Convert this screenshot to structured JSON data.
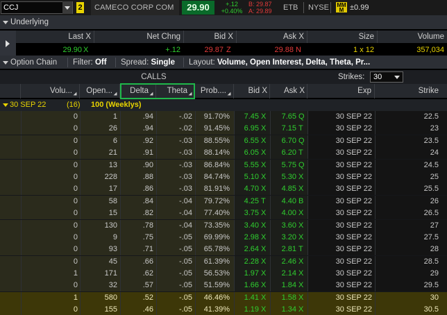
{
  "topbar": {
    "symbol": "CCJ",
    "link_badge": "2",
    "company": "CAMECO CORP COM",
    "last": "29.90",
    "change_abs": "+.12",
    "change_pct": "+0.40%",
    "bid": "B: 29.87",
    "ask": "A: 29.89",
    "exchange1": "ETB",
    "exchange2": "NYSE",
    "mm_icon": "MM M",
    "mm_value": "±0.99"
  },
  "underlying": {
    "title": "Underlying",
    "headers": {
      "last": "Last X",
      "net_chng": "Net Chng",
      "bid": "Bid X",
      "ask": "Ask X",
      "size": "Size",
      "volume": "Volume"
    },
    "values": {
      "last": "29.90",
      "last_ex": "X",
      "net_chng": "+.12",
      "bid": "29.87",
      "bid_ex": "Z",
      "ask": "29.88",
      "ask_ex": "N",
      "size": "1 x 12",
      "volume": "357,034"
    }
  },
  "option_chain": {
    "title": "Option Chain",
    "filter_label": "Filter:",
    "filter_value": "Off",
    "spread_label": "Spread:",
    "spread_value": "Single",
    "layout_label": "Layout:",
    "layout_value": "Volume, Open Interest, Delta, Theta, Pr..."
  },
  "calls_label": "CALLS",
  "strikes_label": "Strikes:",
  "strikes_value": "30",
  "columns": {
    "volume": "Volu...",
    "open": "Open...",
    "delta": "Delta",
    "theta": "Theta",
    "prob": "Prob....",
    "bid": "Bid X",
    "ask": "Ask X",
    "exp": "Exp",
    "strike": "Strike"
  },
  "expiration": {
    "date": "30 SEP 22",
    "count": "(16)",
    "label": "100 (Weeklys)"
  },
  "colors": {
    "green": "#2fcf2f",
    "red": "#e23a3a",
    "yellow": "#e8d300",
    "highlight_box": "#1fb84a"
  },
  "rows": [
    {
      "vol": "0",
      "oi": "1",
      "delta": ".94",
      "theta": "-.02",
      "prob": "91.70%",
      "bid": "7.45",
      "bx": "X",
      "ask": "7.65",
      "ax": "Q",
      "exp": "30 SEP 22",
      "strike": "22.5",
      "itm": true
    },
    {
      "vol": "0",
      "oi": "26",
      "delta": ".94",
      "theta": "-.02",
      "prob": "91.45%",
      "bid": "6.95",
      "bx": "X",
      "ask": "7.15",
      "ax": "T",
      "exp": "30 SEP 22",
      "strike": "23",
      "itm": true
    },
    {
      "vol": "0",
      "oi": "6",
      "delta": ".92",
      "theta": "-.03",
      "prob": "88.55%",
      "bid": "6.55",
      "bx": "X",
      "ask": "6.70",
      "ax": "Q",
      "exp": "30 SEP 22",
      "strike": "23.5",
      "itm": true
    },
    {
      "vol": "0",
      "oi": "21",
      "delta": ".91",
      "theta": "-.03",
      "prob": "88.14%",
      "bid": "6.05",
      "bx": "X",
      "ask": "6.20",
      "ax": "T",
      "exp": "30 SEP 22",
      "strike": "24",
      "itm": true
    },
    {
      "vol": "0",
      "oi": "13",
      "delta": ".90",
      "theta": "-.03",
      "prob": "86.84%",
      "bid": "5.55",
      "bx": "X",
      "ask": "5.75",
      "ax": "Q",
      "exp": "30 SEP 22",
      "strike": "24.5",
      "itm": true
    },
    {
      "vol": "0",
      "oi": "228",
      "delta": ".88",
      "theta": "-.03",
      "prob": "84.74%",
      "bid": "5.10",
      "bx": "X",
      "ask": "5.30",
      "ax": "X",
      "exp": "30 SEP 22",
      "strike": "25",
      "itm": true
    },
    {
      "vol": "0",
      "oi": "17",
      "delta": ".86",
      "theta": "-.03",
      "prob": "81.91%",
      "bid": "4.70",
      "bx": "X",
      "ask": "4.85",
      "ax": "X",
      "exp": "30 SEP 22",
      "strike": "25.5",
      "itm": true
    },
    {
      "vol": "0",
      "oi": "58",
      "delta": ".84",
      "theta": "-.04",
      "prob": "79.72%",
      "bid": "4.25",
      "bx": "T",
      "ask": "4.40",
      "ax": "B",
      "exp": "30 SEP 22",
      "strike": "26",
      "itm": true
    },
    {
      "vol": "0",
      "oi": "15",
      "delta": ".82",
      "theta": "-.04",
      "prob": "77.40%",
      "bid": "3.75",
      "bx": "X",
      "ask": "4.00",
      "ax": "X",
      "exp": "30 SEP 22",
      "strike": "26.5",
      "itm": true
    },
    {
      "vol": "0",
      "oi": "130",
      "delta": ".78",
      "theta": "-.04",
      "prob": "73.35%",
      "bid": "3.40",
      "bx": "X",
      "ask": "3.60",
      "ax": "X",
      "exp": "30 SEP 22",
      "strike": "27",
      "itm": true
    },
    {
      "vol": "0",
      "oi": "9",
      "delta": ".75",
      "theta": "-.05",
      "prob": "69.99%",
      "bid": "2.98",
      "bx": "X",
      "ask": "3.20",
      "ax": "X",
      "exp": "30 SEP 22",
      "strike": "27.5",
      "itm": true
    },
    {
      "vol": "0",
      "oi": "93",
      "delta": ".71",
      "theta": "-.05",
      "prob": "65.78%",
      "bid": "2.64",
      "bx": "X",
      "ask": "2.81",
      "ax": "T",
      "exp": "30 SEP 22",
      "strike": "28",
      "itm": true
    },
    {
      "vol": "0",
      "oi": "45",
      "delta": ".66",
      "theta": "-.05",
      "prob": "61.39%",
      "bid": "2.28",
      "bx": "X",
      "ask": "2.46",
      "ax": "X",
      "exp": "30 SEP 22",
      "strike": "28.5",
      "itm": true
    },
    {
      "vol": "1",
      "oi": "171",
      "delta": ".62",
      "theta": "-.05",
      "prob": "56.53%",
      "bid": "1.97",
      "bx": "X",
      "ask": "2.14",
      "ax": "X",
      "exp": "30 SEP 22",
      "strike": "29",
      "itm": true
    },
    {
      "vol": "0",
      "oi": "32",
      "delta": ".57",
      "theta": "-.05",
      "prob": "51.59%",
      "bid": "1.66",
      "bx": "X",
      "ask": "1.84",
      "ax": "X",
      "exp": "30 SEP 22",
      "strike": "29.5",
      "itm": true
    },
    {
      "vol": "1",
      "oi": "580",
      "delta": ".52",
      "theta": "-.05",
      "prob": "46.46%",
      "bid": "1.41",
      "bx": "X",
      "ask": "1.58",
      "ax": "X",
      "exp": "30 SEP 22",
      "strike": "30",
      "itm": false
    },
    {
      "vol": "0",
      "oi": "155",
      "delta": ".46",
      "theta": "-.05",
      "prob": "41.39%",
      "bid": "1.19",
      "bx": "X",
      "ask": "1.34",
      "ax": "X",
      "exp": "30 SEP 22",
      "strike": "30.5",
      "itm": false
    }
  ]
}
